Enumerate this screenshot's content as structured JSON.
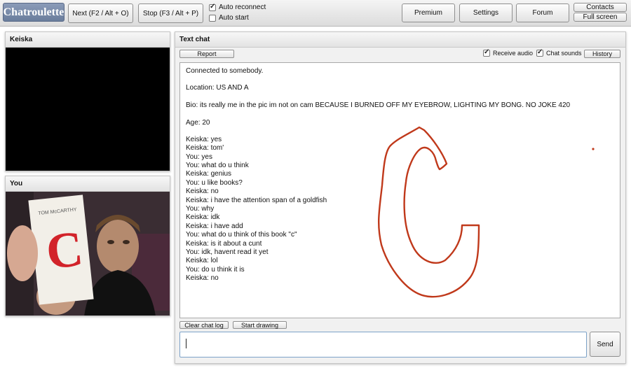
{
  "topbar": {
    "logo": "Chatroulette",
    "next_label": "Next (F2 / Alt + O)",
    "stop_label": "Stop (F3 / Alt + P)",
    "auto_reconnect": {
      "label": "Auto reconnect",
      "checked": true
    },
    "auto_start": {
      "label": "Auto start",
      "checked": false
    },
    "premium_label": "Premium",
    "settings_label": "Settings",
    "forum_label": "Forum",
    "contacts_label": "Contacts",
    "fullscreen_label": "Full screen"
  },
  "stranger_panel": {
    "title": "Keiska"
  },
  "you_panel": {
    "title": "You"
  },
  "text_chat": {
    "title": "Text chat",
    "report_label": "Report",
    "receive_audio": {
      "label": "Receive audio",
      "checked": true
    },
    "chat_sounds": {
      "label": "Chat sounds",
      "checked": true
    },
    "history_label": "History",
    "info": [
      "Connected to somebody.",
      "Location: US AND A",
      "Bio: its really me in the pic im not on cam BECAUSE I BURNED OFF MY EYEBROW, LIGHTING MY BONG. NO JOKE 420",
      "Age: 20"
    ],
    "messages": [
      "Keiska: yes",
      "Keiska: tom'",
      "You: yes",
      "You: what do u think",
      "Keiska: genius",
      "You: u like books?",
      "Keiska: no",
      "Keiska: i have the attention span of a goldfish",
      "You: why",
      "Keiska: idk",
      "Keiska: i have add",
      "You: what do u think of this book \"c\"",
      "Keiska: is it about a cunt",
      "You: idk, havent read it yet",
      "Keiska: lol",
      "You: do u think it is",
      "Keiska: no"
    ],
    "drawing_color": "#c0391b",
    "clear_label": "Clear chat log",
    "draw_label": "Start drawing",
    "input_value": "",
    "send_label": "Send"
  },
  "webcam": {
    "book_letter": "C",
    "book_author": "TOM McCARTHY"
  }
}
